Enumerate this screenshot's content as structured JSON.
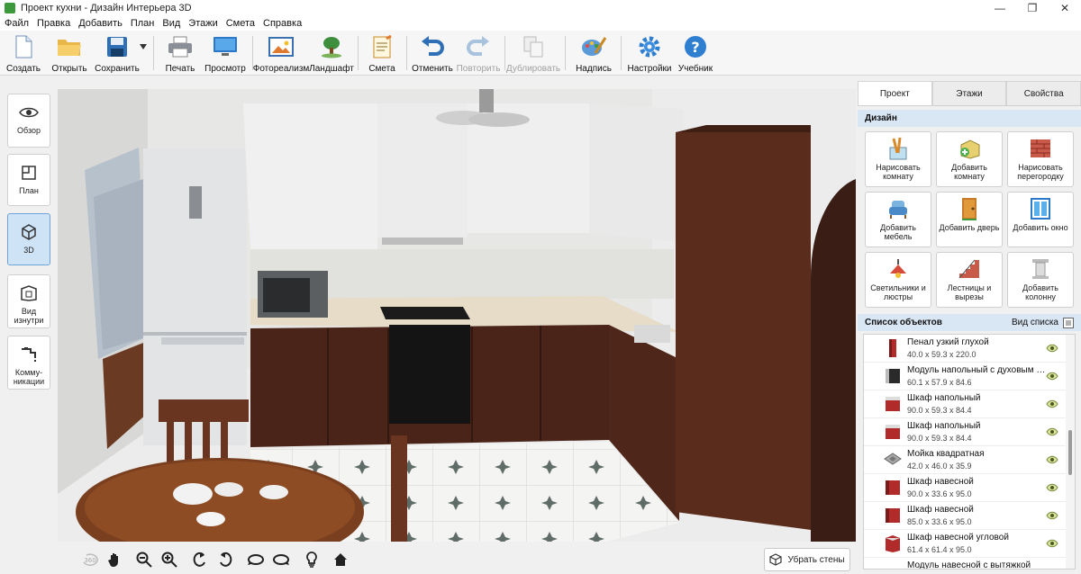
{
  "window": {
    "title": "Проект кухни - Дизайн Интерьера 3D",
    "controls": [
      "—",
      "❐",
      "✕"
    ]
  },
  "menu": [
    "Файл",
    "Правка",
    "Добавить",
    "План",
    "Вид",
    "Этажи",
    "Смета",
    "Справка"
  ],
  "toolbar": {
    "create": "Создать",
    "open": "Открыть",
    "save": "Сохранить",
    "print": "Печать",
    "preview": "Просмотр",
    "photo": "Фотореализм",
    "landscape": "Ландшафт",
    "estimate": "Смета",
    "undo": "Отменить",
    "redo": "Повторить",
    "duplicate": "Дублировать",
    "label": "Надпись",
    "settings": "Настройки",
    "tutorial": "Учебник"
  },
  "left_rail": [
    {
      "label": "Обзор"
    },
    {
      "label": "План"
    },
    {
      "label": "3D"
    },
    {
      "label": "Вид изнутри"
    },
    {
      "label": "Комму-никации"
    }
  ],
  "bottom": {
    "remove_walls": "Убрать стены",
    "rotate_label": "360"
  },
  "panel": {
    "tabs": [
      "Проект",
      "Этажи",
      "Свойства"
    ],
    "design_title": "Дизайн",
    "tiles": [
      {
        "label": "Нарисовать комнату"
      },
      {
        "label": "Добавить комнату"
      },
      {
        "label": "Нарисовать перегородку"
      },
      {
        "label": "Добавить мебель"
      },
      {
        "label": "Добавить дверь"
      },
      {
        "label": "Добавить окно"
      },
      {
        "label": "Светильники и люстры"
      },
      {
        "label": "Лестницы и вырезы"
      },
      {
        "label": "Добавить колонну"
      }
    ],
    "objects_title": "Список объектов",
    "view_list": "Вид списка",
    "objects": [
      {
        "name": "Пенал узкий глухой",
        "dims": "40.0 x 59.3 x 220.0"
      },
      {
        "name": "Модуль напольный с духовым шкафом",
        "dims": "60.1 x 57.9 x 84.6"
      },
      {
        "name": "Шкаф напольный",
        "dims": "90.0 x 59.3 x 84.4"
      },
      {
        "name": "Шкаф напольный",
        "dims": "90.0 x 59.3 x 84.4"
      },
      {
        "name": "Мойка квадратная",
        "dims": "42.0 x 46.0 x 35.9"
      },
      {
        "name": "Шкаф навесной",
        "dims": "90.0 x 33.6 x 95.0"
      },
      {
        "name": "Шкаф навесной",
        "dims": "85.0 x 33.6 x 95.0"
      },
      {
        "name": "Шкаф навесной угловой",
        "dims": "61.4 x 61.4 x 95.0"
      },
      {
        "name": "Модуль навесной с вытяжкой",
        "dims": ""
      }
    ]
  },
  "colors": {
    "accent": "#cfe3f7",
    "panel_header": "#d9e6f4",
    "wood": "#4a2418",
    "cabinet_red": "#b22b2b"
  }
}
